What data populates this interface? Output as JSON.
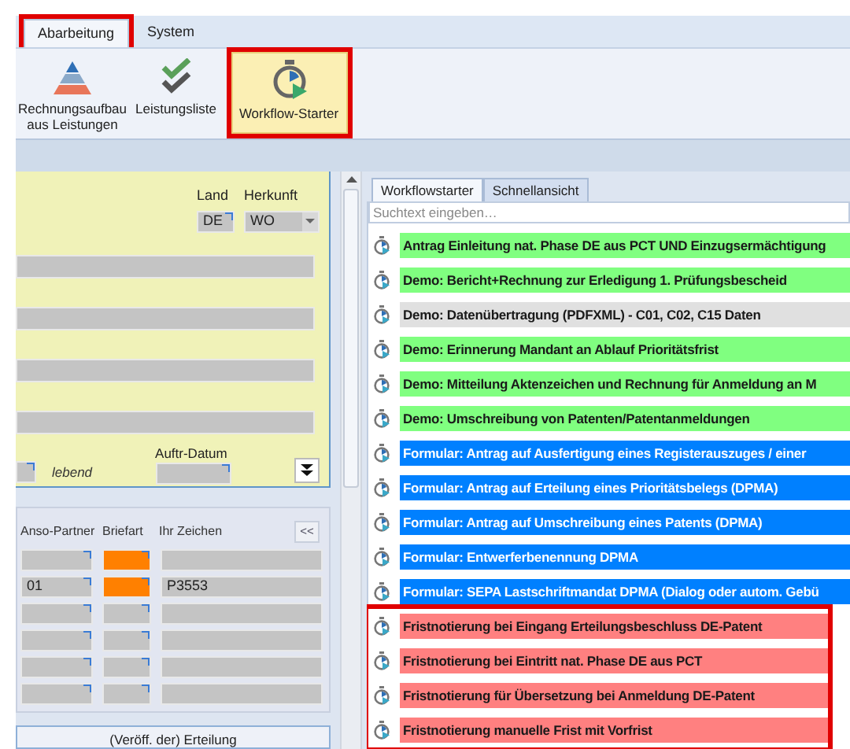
{
  "ribbon": {
    "tabs": [
      {
        "label": "Abarbeitung",
        "selected": true,
        "annotated": true
      },
      {
        "label": "System",
        "selected": false,
        "annotated": false
      }
    ],
    "buttons": [
      {
        "label": "Rechnungsaufbau aus Leistungen",
        "kind": "pyramid",
        "selected": false,
        "annotated": false
      },
      {
        "label": "Leistungsliste",
        "kind": "checks",
        "selected": false,
        "annotated": false
      },
      {
        "label": "Workflow-Starter",
        "kind": "stopwatch",
        "selected": true,
        "annotated": true
      }
    ]
  },
  "address_panel": {
    "land_label": "Land",
    "land": "DE",
    "origin_label": "Herkunft",
    "origin": "WO",
    "status": "lebend",
    "date_label": "Auftr-Datum"
  },
  "partner_panel": {
    "columns": [
      "Anso-Partner",
      "Briefart",
      "Ihr Zeichen"
    ],
    "collapse_button": "<<",
    "rows": [
      {
        "flagged": true
      },
      {
        "partner": "01",
        "flagged": true,
        "reference": "P3553"
      },
      {
        "flagged": false
      },
      {
        "flagged": false
      },
      {
        "flagged": false
      },
      {
        "flagged": false
      }
    ]
  },
  "bottom_panel": {
    "title": "(Veröff. der) Erteilung"
  },
  "workflow_panel": {
    "tabs": [
      {
        "label": "Workflowstarter",
        "selected": true
      },
      {
        "label": "Schnellansicht",
        "selected": false
      }
    ],
    "search": {
      "placeholder": "Suchtext eingeben…"
    },
    "items": [
      {
        "label": "Antrag Einleitung nat. Phase DE aus PCT UND Einzugsermächtigung",
        "color": "#80ff80",
        "annotated": false
      },
      {
        "label": "Demo: Bericht+Rechnung zur Erledigung 1. Prüfungsbescheid",
        "color": "#80ff80",
        "annotated": false
      },
      {
        "label": "Demo: Datenübertragung (PDFXML) - C01, C02, C15 Daten",
        "color": "#e0e0e0",
        "annotated": false
      },
      {
        "label": "Demo: Erinnerung Mandant an Ablauf Prioritätsfrist",
        "color": "#80ff80",
        "annotated": false
      },
      {
        "label": "Demo: Mitteilung Aktenzeichen und Rechnung für Anmeldung an M",
        "color": "#80ff80",
        "annotated": false
      },
      {
        "label": "Demo: Umschreibung von Patenten/Patentanmeldungen",
        "color": "#80ff80",
        "annotated": false
      },
      {
        "label": "Formular: Antrag auf Ausfertigung eines Registerauszuges / einer",
        "color": "#0080ff",
        "annotated": false
      },
      {
        "label": "Formular: Antrag auf Erteilung eines Prioritätsbelegs (DPMA)",
        "color": "#0080ff",
        "annotated": false
      },
      {
        "label": "Formular: Antrag auf Umschreibung eines Patents (DPMA)",
        "color": "#0080ff",
        "annotated": false
      },
      {
        "label": "Formular: Entwerferbenennung DPMA",
        "color": "#0080ff",
        "annotated": false
      },
      {
        "label": "Formular: SEPA Lastschriftmandat DPMA (Dialog oder autom. Gebü",
        "color": "#0080ff",
        "annotated": false
      },
      {
        "label": "Fristnotierung bei Eingang Erteilungsbeschluss DE-Patent",
        "color": "#ff8080",
        "annotated": true
      },
      {
        "label": "Fristnotierung bei Eintritt nat. Phase DE aus PCT",
        "color": "#ff8080",
        "annotated": true
      },
      {
        "label": "Fristnotierung für Übersetzung bei Anmeldung DE-Patent",
        "color": "#ff8080",
        "annotated": true
      },
      {
        "label": "Fristnotierung manuelle Frist mit Vorfrist",
        "color": "#ff8080",
        "annotated": true
      }
    ]
  }
}
